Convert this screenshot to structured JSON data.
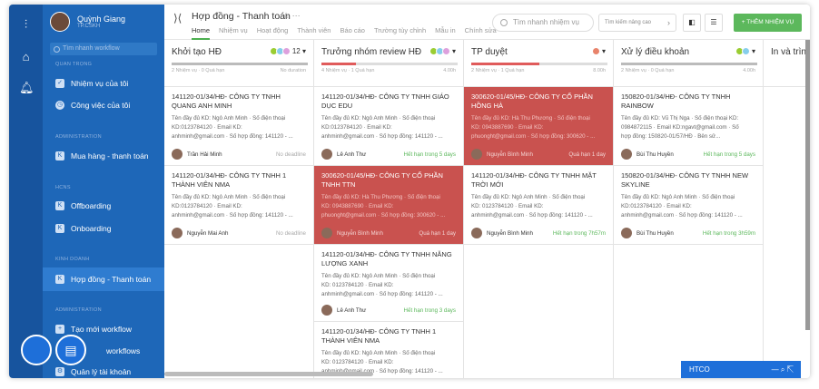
{
  "user": {
    "name": "Quỳnh Giang",
    "role": "TP.CSKH"
  },
  "sidebar": {
    "search_placeholder": "Tìm nhanh workflow",
    "sec_important": "QUAN TRỌNG",
    "my_task": "Nhiệm vụ của tôi",
    "my_job": "Công việc của tôi",
    "sec_admin": "ADMINISTRATION",
    "purchase": "Mua hàng - thanh toán",
    "sec_hcns": "HCNS",
    "offboarding": "Offboarding",
    "onboarding": "Onboarding",
    "sec_sales": "KINH DOANH",
    "contract": "Hợp đồng - Thanh toán",
    "sec_admin2": "ADMINISTRATION",
    "create_wf": "Tạo mới workflow",
    "workflows": "workflows",
    "accounts": "Quản lý tài khoản"
  },
  "header": {
    "title": "Hợp đồng - Thanh toán",
    "star": "☆",
    "more": "···",
    "tabs": [
      "Home",
      "Nhiệm vụ",
      "Hoạt động",
      "Thành viên",
      "Báo cáo",
      "Trường tùy chỉnh",
      "Mẫu in",
      "Chính sửa"
    ],
    "search_placeholder": "Tìm nhanh nhiệm vụ",
    "adv_search": "Tìm kiếm nâng cao",
    "add_button": "+ THÊM NHIỆM VỤ"
  },
  "columns": [
    {
      "title": "Khởi tạo HĐ",
      "meta": "2 Nhiệm vụ · 0 Quá hạn",
      "right": "No duration",
      "count": "12",
      "bar_color": "#bbb",
      "bar_pct": 100
    },
    {
      "title": "Trưởng nhóm review HĐ",
      "meta": "4 Nhiệm vụ · 1 Quá hạn",
      "right": "4.00h",
      "count": "",
      "bar_color": "#e05b5b",
      "bar_pct": 25
    },
    {
      "title": "TP duyệt",
      "meta": "2 Nhiệm vụ · 1 Quá hạn",
      "right": "8.00h",
      "count": "",
      "bar_color": "#e05b5b",
      "bar_pct": 50
    },
    {
      "title": "Xử lý điều khoản",
      "meta": "2 Nhiệm vụ · 0 Quá hạn",
      "right": "4.00h",
      "count": "",
      "bar_color": "#bbb",
      "bar_pct": 100
    },
    {
      "title": "In và trìn",
      "meta": "",
      "right": "",
      "count": "",
      "bar_color": "#bbb",
      "bar_pct": 0
    }
  ],
  "cards": {
    "c1a": {
      "title": "141120-01/34/HĐ- CÔNG TY TNHH QUANG ANH MINH",
      "l1": "Tên đầy đủ KD: Ngô Anh Minh · Số điện thoại",
      "l2": "KD:0123784120 · Email KD:",
      "l3": "anhminh@gmail.com · Số hợp đồng: 141120 - ...",
      "owner": "Trần Hải Minh",
      "status": "No deadline"
    },
    "c1b": {
      "title": "141120-01/34/HĐ- CÔNG TY TNHH 1 THÀNH VIÊN NMA",
      "l1": "Tên đầy đủ KD: Ngô Anh Minh · Số điện thoại",
      "l2": "KD:0123784120 · Email KD:",
      "l3": "anhminh@gmail.com · Số hợp đồng: 141120 - ...",
      "owner": "Nguyễn Mai Anh",
      "status": "No deadline"
    },
    "c2a": {
      "title": "141120-01/34/HĐ- CÔNG TY TNHH GIÁO DỤC EDU",
      "l1": "Tên đầy đủ KD: Ngô Anh Minh · Số điện thoại",
      "l2": "KD:0123784120 · Email KD:",
      "l3": "anhminh@gmail.com · Số hợp đồng: 141120 - ...",
      "owner": "Lê Anh Thư",
      "status": "Hết hạn trong 5 days"
    },
    "c2b": {
      "title": "300620-01/45/HĐ- CÔNG TY CỔ PHẦN TNHH TTN",
      "l1": "Tên đầy đủ KD: Hà Thu Phương · Số điện thoại",
      "l2": "KD: 0943887690 · Email KD:",
      "l3": "phuonght@gmail.com · Số hợp đồng: 300620 - ...",
      "owner": "Nguyễn Bình Minh",
      "status": "Quá hạn 1 day"
    },
    "c2c": {
      "title": "141120-01/34/HĐ- CÔNG TY TNHH NĂNG LƯỢNG XANH",
      "l1": "Tên đầy đủ KD: Ngô Anh Minh · Số điện thoại",
      "l2": "KD: 0123784120 · Email KD:",
      "l3": "anhminh@gmail.com · Số hợp đồng: 141120 - ...",
      "owner": "Lê Anh Thư",
      "status": "Hết hạn trong 3 days"
    },
    "c2d": {
      "title": "141120-01/34/HĐ- CÔNG TY TNHH 1 THÀNH VIÊN NMA",
      "l1": "Tên đầy đủ KD: Ngô Anh Minh · Số điện thoại",
      "l2": "KD: 0123784120 · Email KD:",
      "l3": "anhminh@gmail.com · Số hợp đồng: 141120 - ...",
      "owner": "",
      "status": ""
    },
    "c3a": {
      "title": "300620-01/45/HĐ- CÔNG TY CỔ PHẦN HỒNG HÀ",
      "l1": "Tên đầy đủ KD: Hà Thu Phương · Số điện thoại",
      "l2": "KD: 0943887690 · Email KD:",
      "l3": "phuonght@gmail.com · Số hợp đồng: 300620 - ...",
      "owner": "Nguyễn Bình Minh",
      "status": "Quá hạn 1 day"
    },
    "c3b": {
      "title": "141120-01/34/HĐ- CÔNG TY TNHH MẶT TRỜI MỚI",
      "l1": "Tên đầy đủ KD: Ngô Anh Minh · Số điện thoại",
      "l2": "KD: 0123784120 · Email KD:",
      "l3": "anhminh@gmail.com · Số hợp đồng: 141120 - ...",
      "owner": "Nguyễn Bình Minh",
      "status": "Hết hạn trong 7h57m"
    },
    "c4a": {
      "title": "150820-01/34/HĐ- CÔNG TY TNHH RAINBOW",
      "l1": "Tên đầy đủ KD: Vũ Thị Nga · Số điện thoại KD:",
      "l2": "0984872115 · Email KD:ngavt@gmail.com · Số",
      "l3": "hợp đồng: 150820-01/57/HĐ · Bên sử...",
      "owner": "Bùi Thu Huyền",
      "status": "Hết hạn trong 5 days"
    },
    "c4b": {
      "title": "150820-01/34/HĐ- CÔNG TY TNHH NEW SKYLINE",
      "l1": "Tên đầy đủ KD: Ngô Anh Minh · Số điện thoại",
      "l2": "KD:0123784120 · Email KD:",
      "l3": "anhminh@gmail.com · Số hợp đồng: 141120 - ...",
      "owner": "Bùi Thu Huyền",
      "status": "Hết hạn trong 3h59m"
    }
  },
  "chat": {
    "label": "HTCO"
  },
  "colors": {
    "rail": "#17549e",
    "sidebar": "#1e67b8",
    "accent": "#5cb85c",
    "overdue": "#c9524f"
  }
}
